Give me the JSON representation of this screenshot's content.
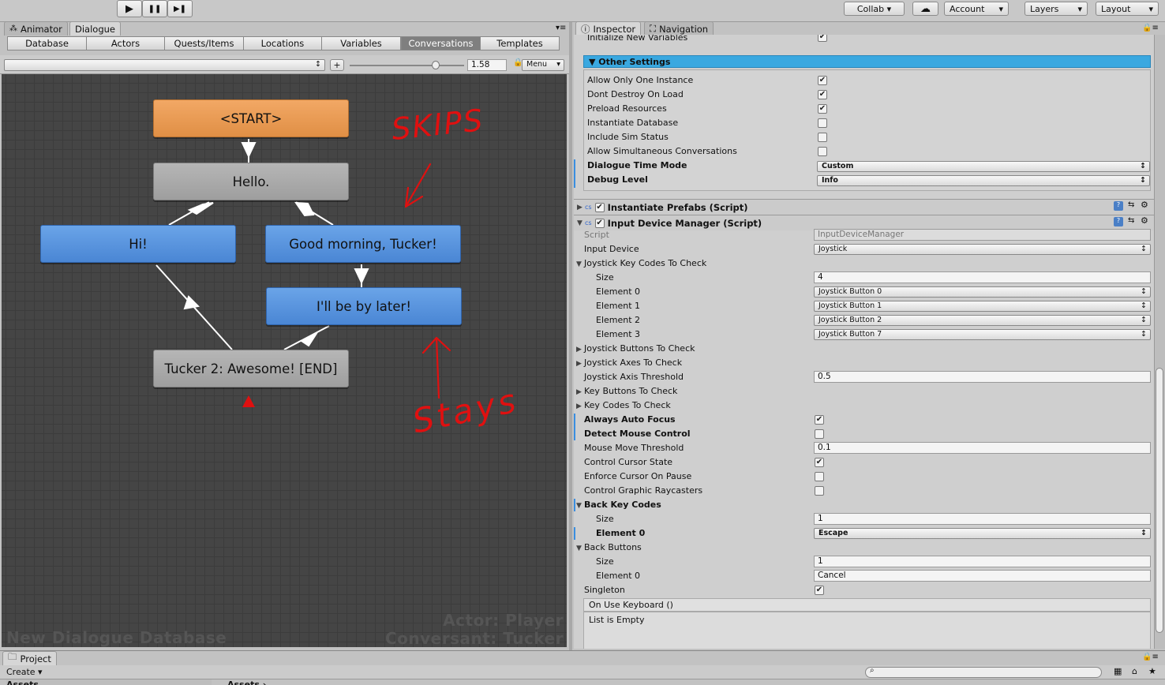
{
  "toolbar": {
    "play": "▶",
    "pause": "❚❚",
    "step": "▶❚",
    "collab": "Collab ▾",
    "cloud": "☁",
    "account": "Account",
    "layers": "Layers",
    "layout": "Layout"
  },
  "left_tabs": {
    "animator": "Animator",
    "dialogue": "Dialogue"
  },
  "editor_tabs": [
    "Database",
    "Actors",
    "Quests/Items",
    "Locations",
    "Variables",
    "Conversations",
    "Templates"
  ],
  "conv_bar": {
    "add": "+",
    "zoom": "1.58",
    "menu": "Menu"
  },
  "nodes": {
    "start": "<START>",
    "hello": "Hello.",
    "hi": "Hi!",
    "good_morning": "Good morning, Tucker!",
    "later": "I'll be by later!",
    "end": "Tucker 2: Awesome! [END]"
  },
  "watermark": {
    "db": "New Dialogue Database",
    "actor": "Actor: Player",
    "conversant": "Conversant: Tucker"
  },
  "right_tabs": {
    "inspector": "Inspector",
    "navigation": "Navigation"
  },
  "inspector": {
    "init_vars": "Initialize New Variables",
    "other_settings": "Other Settings",
    "settings": [
      {
        "label": "Allow Only One Instance",
        "checked": true
      },
      {
        "label": "Dont Destroy On Load",
        "checked": true
      },
      {
        "label": "Preload Resources",
        "checked": true
      },
      {
        "label": "Instantiate Database",
        "checked": false
      },
      {
        "label": "Include Sim Status",
        "checked": false
      },
      {
        "label": "Allow Simultaneous Conversations",
        "checked": false
      }
    ],
    "dialogue_time_mode": "Dialogue Time Mode",
    "dialogue_time_value": "Custom",
    "debug_level": "Debug Level",
    "debug_value": "Info",
    "instantiate_prefabs": "Instantiate Prefabs (Script)",
    "input_device_manager": "Input Device Manager (Script)",
    "script_label": "Script",
    "script_value": "InputDeviceManager",
    "input_device": "Input Device",
    "input_device_value": "Joystick",
    "jkc": "Joystick Key Codes To Check",
    "size": "Size",
    "jkc_size": "4",
    "el0": "Element 0",
    "el1": "Element 1",
    "el2": "Element 2",
    "el3": "Element 3",
    "jb0": "Joystick Button 0",
    "jb1": "Joystick Button 1",
    "jb2": "Joystick Button 2",
    "jb7": "Joystick Button 7",
    "jbtc": "Joystick Buttons To Check",
    "jatc": "Joystick Axes To Check",
    "jat": "Joystick Axis Threshold",
    "jat_value": "0.5",
    "kbtc": "Key Buttons To Check",
    "kctc": "Key Codes To Check",
    "aaf": "Always Auto Focus",
    "dmc": "Detect Mouse Control",
    "mmt": "Mouse Move Threshold",
    "mmt_value": "0.1",
    "ccs": "Control Cursor State",
    "ecop": "Enforce Cursor On Pause",
    "cgr": "Control Graphic Raycasters",
    "bkc": "Back Key Codes",
    "bkc_size": "1",
    "escape": "Escape",
    "bb": "Back Buttons",
    "bb_size": "1",
    "cancel": "Cancel",
    "singleton": "Singleton",
    "on_use": "On Use Keyboard ()",
    "list_empty": "List is Empty"
  },
  "bottom": {
    "project": "Project",
    "create": "Create ▾",
    "assets": "Assets",
    "assets2": "Assets ›"
  },
  "annotations": {
    "skips": "SKIPS",
    "stays": "Stays"
  },
  "colors": {
    "accent": "#3aa8e0",
    "start": "#eea05a",
    "npc": "#a8a8a8",
    "pc": "#5b95de",
    "annot": "#e01010"
  }
}
